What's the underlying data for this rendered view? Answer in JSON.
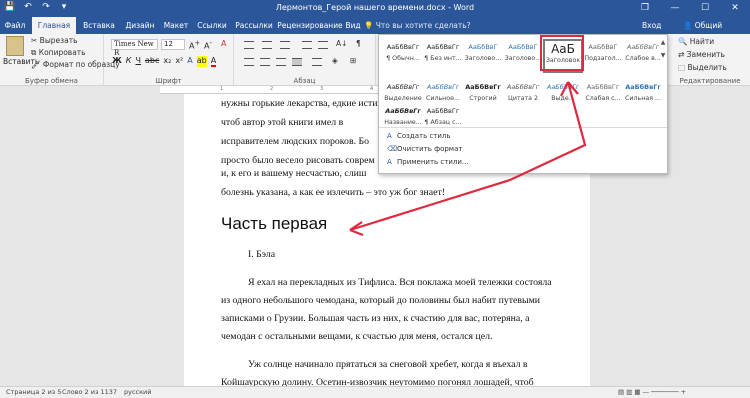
{
  "titlebar": {
    "title": "Лермонтов_Герой нашего времени.docx - Word",
    "qat_save": "💾",
    "qat_undo": "↶",
    "qat_redo": "↷",
    "qat_more": "▾",
    "restore": "❐",
    "minimize": "—",
    "maximize": "☐",
    "close": "✕"
  },
  "tabs": [
    "Файл",
    "Главная",
    "Вставка",
    "Дизайн",
    "Макет",
    "Ссылки",
    "Рассылки",
    "Рецензирование",
    "Вид"
  ],
  "tellme": "Что вы хотите сделать?",
  "signin": "Вход",
  "share": "Общий доступ",
  "clipboard": {
    "paste": "Вставить",
    "cut": "Вырезать",
    "copy": "Копировать",
    "format_painter": "Формат по образцу",
    "label": "Буфер обмена"
  },
  "font": {
    "name": "Times New R",
    "size": "12",
    "bold": "Ж",
    "italic": "К",
    "underline": "Ч",
    "label": "Шрифт"
  },
  "paragraph": {
    "label": "Абзац"
  },
  "styles": [
    {
      "preview": "АаБбВвГг",
      "name": "¶ Обычн..."
    },
    {
      "preview": "АаБбВвГг",
      "name": "¶ Без инт..."
    },
    {
      "preview": "АаБбВвГ",
      "name": "Заголово..."
    },
    {
      "preview": "АаБбВвГ",
      "name": "Заголово..."
    },
    {
      "preview": "АаБ",
      "name": "Заголовок"
    },
    {
      "preview": "АаБбВвГ",
      "name": "Подзагол..."
    },
    {
      "preview": "АаБбВвГг",
      "name": "Слабое в..."
    }
  ],
  "dropdown": {
    "row2": [
      {
        "preview": "АаБбВвГг",
        "name": "Выделение"
      },
      {
        "preview": "АаБбВвГг",
        "name": "Сильное..."
      },
      {
        "preview": "АаБбВвГг",
        "name": "Строгий"
      },
      {
        "preview": "АаБбВвГг",
        "name": "Цитата 2"
      },
      {
        "preview": "АаБбВвГг",
        "name": "Выде..."
      },
      {
        "preview": "АаБбВвГг",
        "name": "Слабая с..."
      },
      {
        "preview": "АаБбВвГг",
        "name": "Сильная ..."
      }
    ],
    "row3": [
      {
        "preview": "АаБбВвГг",
        "name": "Название..."
      },
      {
        "preview": "АаБбВвГг",
        "name": "¶ Абзац с..."
      }
    ],
    "menu": [
      "Создать стиль",
      "Очистить формат",
      "Применить стили..."
    ]
  },
  "editing": {
    "find": "Найти",
    "replace": "Заменить",
    "select": "Выделить",
    "label": "Редактирование"
  },
  "document": {
    "lines": [
      "нужны горькие лекарства, едкие истины.",
      "чтоб автор этой книги имел в",
      "исправителем людских пороков. Бо",
      "просто было весело рисовать соврем",
      "и, к его и вашему несчастью, слиш",
      "болезнь указана, а как ее излечить – это уж бог знает!"
    ],
    "heading": "Часть первая",
    "subheading": "I. Бэла",
    "para1": [
      "Я ехал на перекладных из Тифлиса. Вся поклажа моей тележки состояла",
      "из одного небольшого чемодана, который до половины был набит путевыми",
      "записками о Грузии. Большая часть из них, к счастию для вас, потеряна, а",
      "чемодан с остальными вещами, к счастью для меня, остался цел."
    ],
    "para2": [
      "Уж солнце начинало прятаться за снеговой хребет, когда я въехал в",
      "Койшаурскую долину. Осетин-извозчик неутомимо погонял лошадей, чтоб"
    ]
  },
  "status": {
    "page": "Страница 2 из 5",
    "words": "Слово 2 из 1137",
    "lang": "русский"
  },
  "accent_color": "#2b579a",
  "arrow_color": "#e0283e"
}
